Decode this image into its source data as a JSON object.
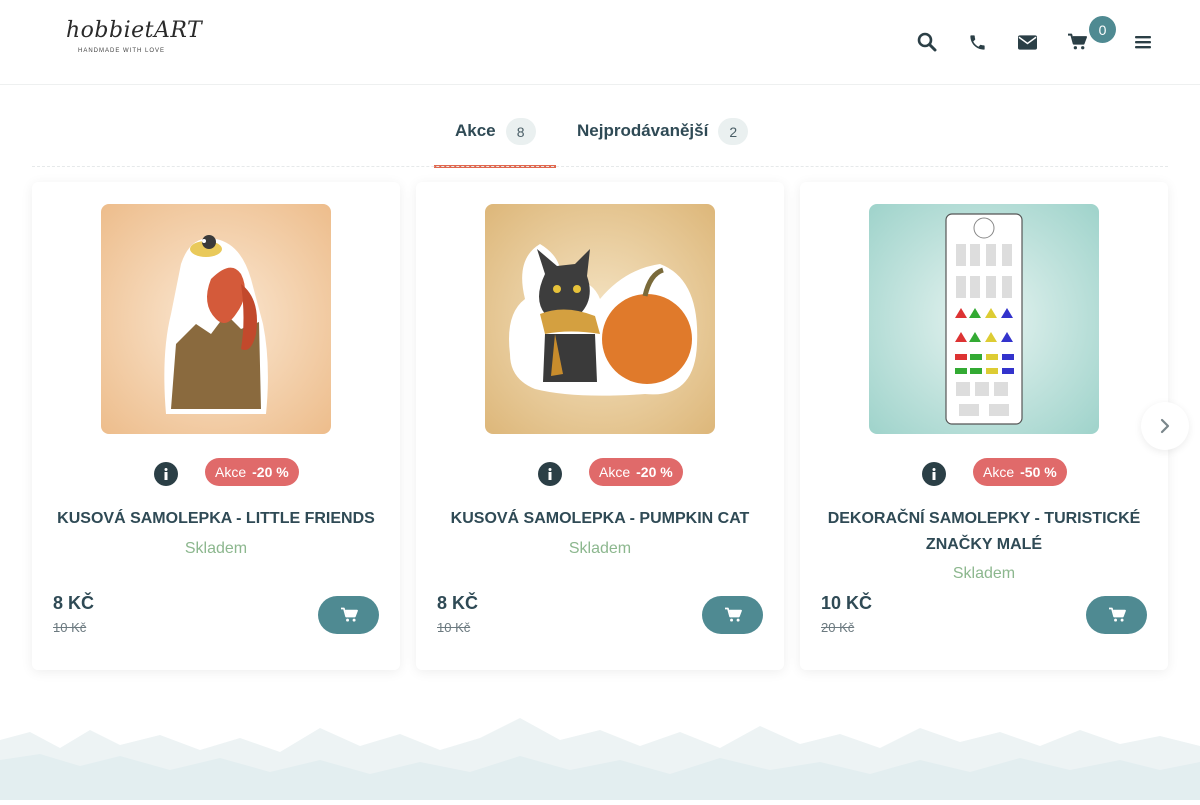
{
  "header": {
    "logo_text": "hobbietART",
    "logo_tagline": "HANDMADE WITH LOVE",
    "cart_count": "0",
    "icons": [
      "search-icon",
      "phone-icon",
      "envelope-icon",
      "cart-icon",
      "menu-icon"
    ]
  },
  "tabs": [
    {
      "label": "Akce",
      "count": "8",
      "active": true
    },
    {
      "label": "Nejprodávanější",
      "count": "2",
      "active": false
    }
  ],
  "products": [
    {
      "title": "KUSOVÁ SAMOLEPKA - LITTLE FRIENDS",
      "sale_label": "Akce",
      "discount": "-20 %",
      "stock": "Skladem",
      "price": "8 KČ",
      "old_price": "10 Kč",
      "image": "squirrel-and-bird-sticker"
    },
    {
      "title": "KUSOVÁ SAMOLEPKA - PUMPKIN CAT",
      "sale_label": "Akce",
      "discount": "-20 %",
      "stock": "Skladem",
      "price": "8 KČ",
      "old_price": "10 Kč",
      "image": "cat-with-pumpkin-sticker"
    },
    {
      "title": "DEKORAČNÍ SAMOLEPKY - TURISTICKÉ ZNAČKY MALÉ",
      "sale_label": "Akce",
      "discount": "-50 %",
      "stock": "Skladem",
      "price": "10 KČ",
      "old_price": "20 Kč",
      "image": "hiking-signs-sticker-sheet"
    }
  ],
  "colors": {
    "accent": "#4f8a92",
    "sale": "#e06a6a",
    "tab_underline": "#e0684f",
    "stock": "#8cb78e",
    "text": "#2f4a55"
  }
}
